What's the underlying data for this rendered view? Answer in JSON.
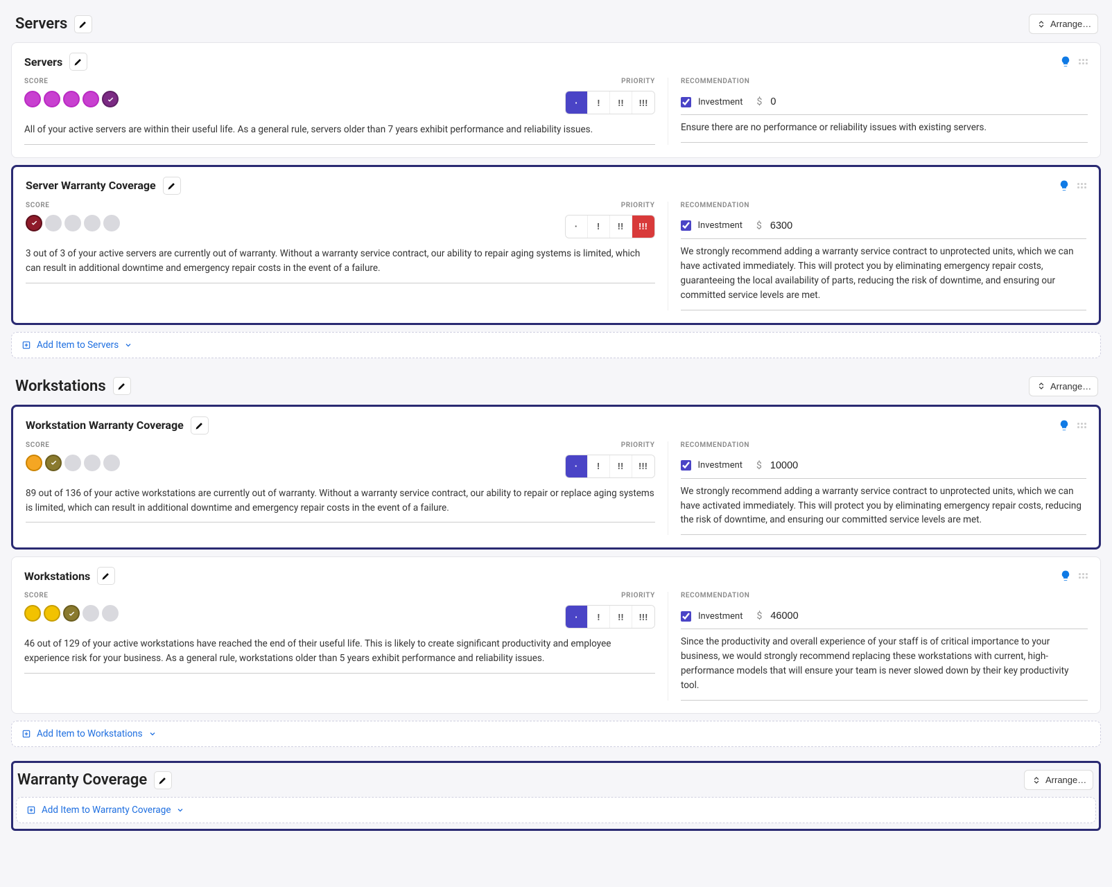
{
  "labels": {
    "score": "SCORE",
    "priority": "PRIORITY",
    "recommendation": "RECOMMENDATION",
    "investment": "Investment",
    "arrange": "Arrange…"
  },
  "priority_levels": [
    "·",
    "!",
    "!!",
    "!!!"
  ],
  "sections": [
    {
      "id": "servers",
      "title": "Servers",
      "add_label": "Add Item to Servers",
      "cards": [
        {
          "id": "servers_card",
          "title": "Servers",
          "selected": false,
          "score": {
            "dots": [
              "purple",
              "purple",
              "purple",
              "purple",
              "purple-check"
            ]
          },
          "priority_active": 0,
          "priority_style": "purple",
          "desc": "All of your active servers are within their useful life. As a general rule, servers older than 7 years exhibit performance and reliability issues.",
          "investment_checked": true,
          "investment_amount": "0",
          "rec_desc": "Ensure there are no performance or reliability issues with existing servers."
        },
        {
          "id": "server_warranty",
          "title": "Server Warranty Coverage",
          "selected": true,
          "score": {
            "dots": [
              "maroon-check",
              "grey",
              "grey",
              "grey",
              "grey"
            ]
          },
          "priority_active": 3,
          "priority_style": "red",
          "desc": "3 out of 3 of your active servers are currently out of warranty. Without a warranty service contract, our ability to repair aging systems is limited, which can result in additional downtime and emergency repair costs in the event of a failure.",
          "investment_checked": true,
          "investment_amount": "6300",
          "rec_desc": "We strongly recommend adding a warranty service contract to unprotected units, which we can have activated immediately. This will protect you by eliminating emergency repair costs, guaranteeing the local availability of parts, reducing the risk of downtime, and ensuring our committed service levels are met."
        }
      ]
    },
    {
      "id": "workstations",
      "title": "Workstations",
      "add_label": "Add Item to Workstations",
      "cards": [
        {
          "id": "ws_warranty",
          "title": "Workstation Warranty Coverage",
          "selected": true,
          "score": {
            "dots": [
              "orange",
              "olive-check",
              "grey",
              "grey",
              "grey"
            ]
          },
          "priority_active": 0,
          "priority_style": "purple",
          "desc": "89 out of 136 of your active workstations are currently out of warranty. Without a warranty service contract, our ability to repair or replace aging systems is limited, which can result in additional downtime and emergency repair costs in the event of a failure.",
          "investment_checked": true,
          "investment_amount": "10000",
          "rec_desc": "We strongly recommend adding a warranty service contract to unprotected units, which we can have activated immediately. This will protect you by eliminating emergency repair costs, reducing the risk of downtime, and ensuring our committed service levels are met."
        },
        {
          "id": "ws_card",
          "title": "Workstations",
          "selected": false,
          "score": {
            "dots": [
              "yellow",
              "yellow",
              "olive-check",
              "grey",
              "grey"
            ]
          },
          "priority_active": 0,
          "priority_style": "purple",
          "desc": "46 out of 129 of your active workstations have reached the end of their useful life. This is likely to create significant productivity and employee experience risk for your business. As a general rule, workstations older than 5 years exhibit performance and reliability issues.",
          "investment_checked": true,
          "investment_amount": "46000",
          "rec_desc": "Since the productivity and overall experience of your staff is of critical importance to your business, we would strongly recommend replacing these workstations with current, high-performance models that will ensure your team is never slowed down by their key productivity tool."
        }
      ]
    },
    {
      "id": "warranty_coverage",
      "title": "Warranty Coverage",
      "add_label": "Add Item to Warranty Coverage",
      "cards": []
    }
  ]
}
